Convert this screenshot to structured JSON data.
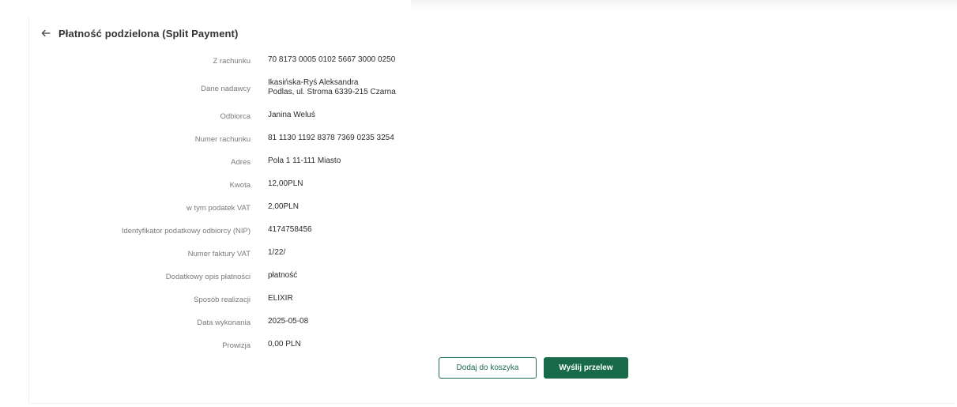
{
  "header": {
    "title": "Płatność podzielona (Split Payment)",
    "back_icon": "arrow-left-icon"
  },
  "details": [
    {
      "label": "Z rachunku",
      "value": "70 8173 0005 0102 5667 3000 0250"
    },
    {
      "label": "Dane nadawcy",
      "value": "Ikasińska-Ryś Aleksandra",
      "value2": "Podlas, ul. Stroma 6339-215 Czarna"
    },
    {
      "label": "Odbiorca",
      "value": "Janina Weluś"
    },
    {
      "label": "Numer rachunku",
      "value": "81 1130 1192 8378 7369 0235 3254"
    },
    {
      "label": "Adres",
      "value": "Pola 1 11-111 Miasto"
    },
    {
      "label": "Kwota",
      "value": "12,00PLN"
    },
    {
      "label": "w tym podatek VAT",
      "value": "2,00PLN"
    },
    {
      "label": "Identyfikator podatkowy odbiorcy (NIP)",
      "value": "4174758456"
    },
    {
      "label": "Numer faktury VAT",
      "value": "1/22/"
    },
    {
      "label": "Dodatkowy opis płatności",
      "value": "płatność"
    },
    {
      "label": "Sposób realizacji",
      "value": "ELIXIR"
    },
    {
      "label": "Data wykonania",
      "value": "2025-05-08"
    },
    {
      "label": "Prowizja",
      "value": "0,00 PLN"
    }
  ],
  "actions": {
    "add_to_cart_label": "Dodaj do koszyka",
    "send_label": "Wyślij przelew"
  },
  "colors": {
    "primary": "#186a4a",
    "label_text": "#7a7a7a",
    "value_text": "#2b2b2b"
  }
}
